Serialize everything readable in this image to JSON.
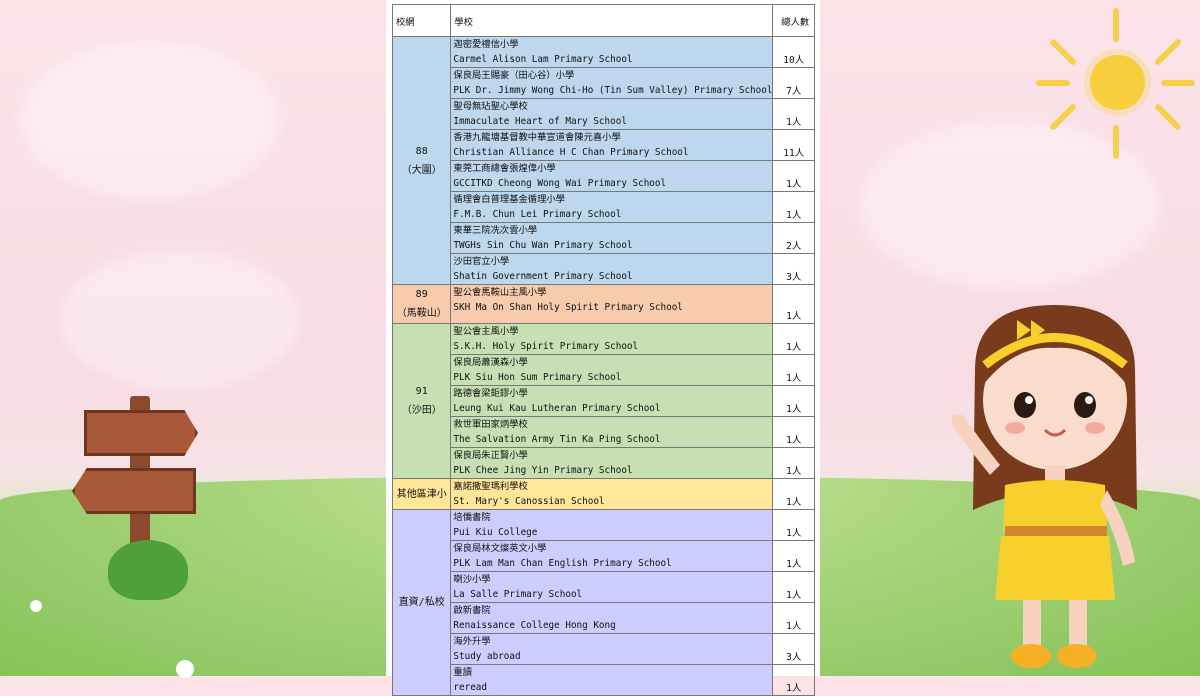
{
  "table": {
    "headers": [
      "校網",
      "學校",
      "總人數"
    ],
    "groups": [
      {
        "region": "88",
        "region_sub": "（大圍）",
        "color": "#bdd7ee",
        "rows": [
          {
            "zh": "迦密愛禮信小學",
            "en": "Carmel Alison Lam Primary School",
            "count": "10人"
          },
          {
            "zh": "保良局王賜豪（田心谷）小學",
            "en": "PLK Dr. Jimmy Wong Chi-Ho (Tin Sum Valley) Primary School",
            "count": "7人"
          },
          {
            "zh": "聖母無玷聖心學校",
            "en": "Immaculate Heart of Mary School",
            "count": "1人"
          },
          {
            "zh": "香港九龍塘基督教中華宣道會陳元喜小學",
            "en": "Christian Alliance H C Chan Primary School",
            "count": "11人"
          },
          {
            "zh": "東莞工商總會張煌偉小學",
            "en": "GCCITKD Cheong Wong Wai Primary School",
            "count": "1人"
          },
          {
            "zh": "循理會白普理基金循理小學",
            "en": "F.M.B. Chun Lei Primary School",
            "count": "1人"
          },
          {
            "zh": "東華三院冼次雲小學",
            "en": "TWGHs Sin Chu Wan Primary School",
            "count": "2人"
          },
          {
            "zh": "沙田官立小學",
            "en": "Shatin Government Primary School",
            "count": "3人"
          }
        ]
      },
      {
        "region": "89",
        "region_sub": "（馬鞍山）",
        "color": "#f8cbad",
        "rows": [
          {
            "zh": "聖公會馬鞍山主風小學",
            "en": "SKH Ma On Shan Holy Spirit Primary School",
            "count": "1人"
          }
        ]
      },
      {
        "region": "91",
        "region_sub": "（沙田）",
        "color": "#c6e0b4",
        "rows": [
          {
            "zh": "聖公會主風小學",
            "en": "S.K.H. Holy Spirit Primary School",
            "count": "1人"
          },
          {
            "zh": "保良局蕭漢森小學",
            "en": "PLK Siu Hon Sum Primary School",
            "count": "1人"
          },
          {
            "zh": "路德會梁鉅鏐小學",
            "en": "Leung Kui Kau Lutheran Primary School",
            "count": "1人"
          },
          {
            "zh": "救世軍田家炳學校",
            "en": "The Salvation Army Tin Ka Ping School",
            "count": "1人"
          },
          {
            "zh": "保良局朱正賢小學",
            "en": "PLK Chee Jing Yin Primary School",
            "count": "1人"
          }
        ]
      },
      {
        "region": "其他區津小",
        "region_sub": "",
        "color": "#ffe699",
        "rows": [
          {
            "zh": "嘉諾撒聖瑪利學校",
            "en": "St. Mary's Canossian School",
            "count": "1人"
          }
        ]
      },
      {
        "region": "直資/私校",
        "region_sub": "",
        "color": "#ccccff",
        "rows": [
          {
            "zh": "培僑書院",
            "en": "Pui Kiu College",
            "count": "1人"
          },
          {
            "zh": "保良局林文燦英文小學",
            "en": "PLK Lam Man Chan English Primary School",
            "count": "1人"
          },
          {
            "zh": "喇沙小學",
            "en": "La Salle Primary School",
            "count": "1人"
          },
          {
            "zh": "啟新書院",
            "en": "Renaissance College Hong Kong",
            "count": "1人"
          },
          {
            "zh": "海外升學",
            "en": "Study abroad",
            "count": "3人"
          },
          {
            "zh": "重讀",
            "en": "reread",
            "count": "1人"
          }
        ]
      }
    ]
  },
  "decor": {
    "signpost_icon": "wooden-signpost",
    "sun_icon": "smiling-sun",
    "girl_icon": "waving-girl-illustration",
    "colors": {
      "sky": "#fbe3e8",
      "grass": "#9fd07a",
      "sun": "#f7cf3c",
      "dress": "#f7d02b"
    }
  }
}
